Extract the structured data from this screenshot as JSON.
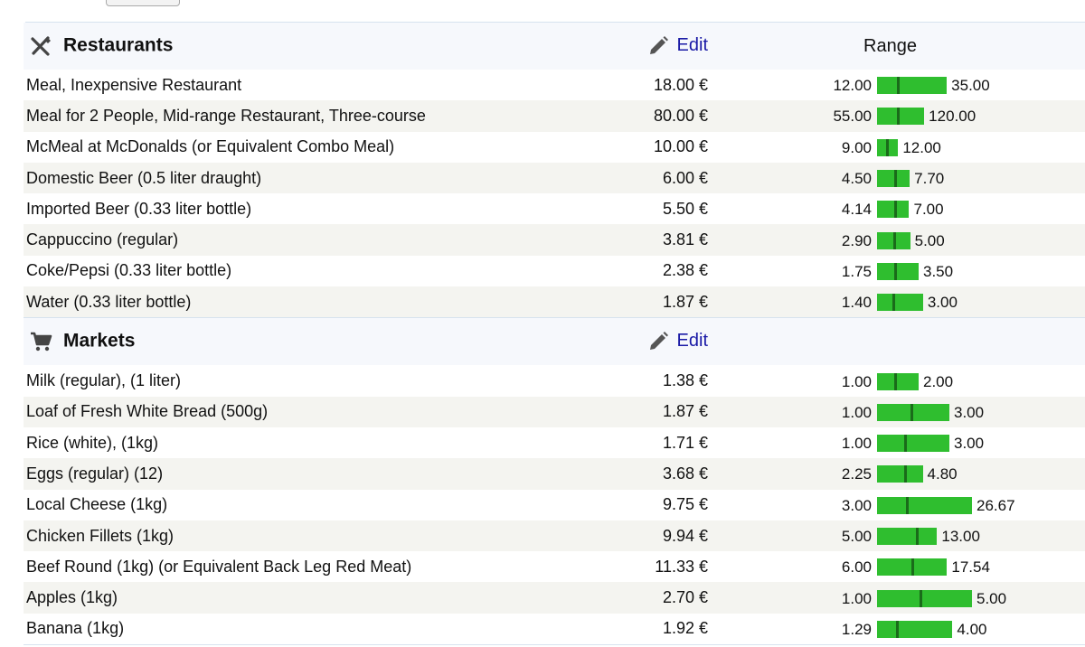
{
  "currency": "€",
  "colors": {
    "bar": "#2fbe2f",
    "marker": "#1a6b1a",
    "link": "#1a1aa6"
  },
  "categories": [
    {
      "title": "Restaurants",
      "icon": "fork-knife-icon",
      "edit_label": "Edit",
      "range_label": "Range",
      "items": [
        {
          "name": "Meal, Inexpensive Restaurant",
          "price": "18.00 €",
          "low": "12.00",
          "high": "35.00",
          "v": 18.0,
          "l": 12.0,
          "h": 35.0
        },
        {
          "name": "Meal for 2 People, Mid-range Restaurant, Three-course",
          "price": "80.00 €",
          "low": "55.00",
          "high": "120.00",
          "v": 80.0,
          "l": 55.0,
          "h": 120.0
        },
        {
          "name": "McMeal at McDonalds (or Equivalent Combo Meal)",
          "price": "10.00 €",
          "low": "9.00",
          "high": "12.00",
          "v": 10.0,
          "l": 9.0,
          "h": 12.0
        },
        {
          "name": "Domestic Beer (0.5 liter draught)",
          "price": "6.00 €",
          "low": "4.50",
          "high": "7.70",
          "v": 6.0,
          "l": 4.5,
          "h": 7.7
        },
        {
          "name": "Imported Beer (0.33 liter bottle)",
          "price": "5.50 €",
          "low": "4.14",
          "high": "7.00",
          "v": 5.5,
          "l": 4.14,
          "h": 7.0
        },
        {
          "name": "Cappuccino (regular)",
          "price": "3.81 €",
          "low": "2.90",
          "high": "5.00",
          "v": 3.81,
          "l": 2.9,
          "h": 5.0
        },
        {
          "name": "Coke/Pepsi (0.33 liter bottle)",
          "price": "2.38 €",
          "low": "1.75",
          "high": "3.50",
          "v": 2.38,
          "l": 1.75,
          "h": 3.5
        },
        {
          "name": "Water (0.33 liter bottle)",
          "price": "1.87 €",
          "low": "1.40",
          "high": "3.00",
          "v": 1.87,
          "l": 1.4,
          "h": 3.0
        }
      ]
    },
    {
      "title": "Markets",
      "icon": "shopping-cart-icon",
      "edit_label": "Edit",
      "range_label": "",
      "items": [
        {
          "name": "Milk (regular), (1 liter)",
          "price": "1.38 €",
          "low": "1.00",
          "high": "2.00",
          "v": 1.38,
          "l": 1.0,
          "h": 2.0
        },
        {
          "name": "Loaf of Fresh White Bread (500g)",
          "price": "1.87 €",
          "low": "1.00",
          "high": "3.00",
          "v": 1.87,
          "l": 1.0,
          "h": 3.0
        },
        {
          "name": "Rice (white), (1kg)",
          "price": "1.71 €",
          "low": "1.00",
          "high": "3.00",
          "v": 1.71,
          "l": 1.0,
          "h": 3.0
        },
        {
          "name": "Eggs (regular) (12)",
          "price": "3.68 €",
          "low": "2.25",
          "high": "4.80",
          "v": 3.68,
          "l": 2.25,
          "h": 4.8
        },
        {
          "name": "Local Cheese (1kg)",
          "price": "9.75 €",
          "low": "3.00",
          "high": "26.67",
          "v": 9.75,
          "l": 3.0,
          "h": 26.67
        },
        {
          "name": "Chicken Fillets (1kg)",
          "price": "9.94 €",
          "low": "5.00",
          "high": "13.00",
          "v": 9.94,
          "l": 5.0,
          "h": 13.0
        },
        {
          "name": "Beef Round (1kg) (or Equivalent Back Leg Red Meat)",
          "price": "11.33 €",
          "low": "6.00",
          "high": "17.54",
          "v": 11.33,
          "l": 6.0,
          "h": 17.54
        },
        {
          "name": "Apples (1kg)",
          "price": "2.70 €",
          "low": "1.00",
          "high": "5.00",
          "v": 2.7,
          "l": 1.0,
          "h": 5.0
        },
        {
          "name": "Banana (1kg)",
          "price": "1.92 €",
          "low": "1.29",
          "high": "4.00",
          "v": 1.92,
          "l": 1.29,
          "h": 4.0
        }
      ]
    }
  ]
}
